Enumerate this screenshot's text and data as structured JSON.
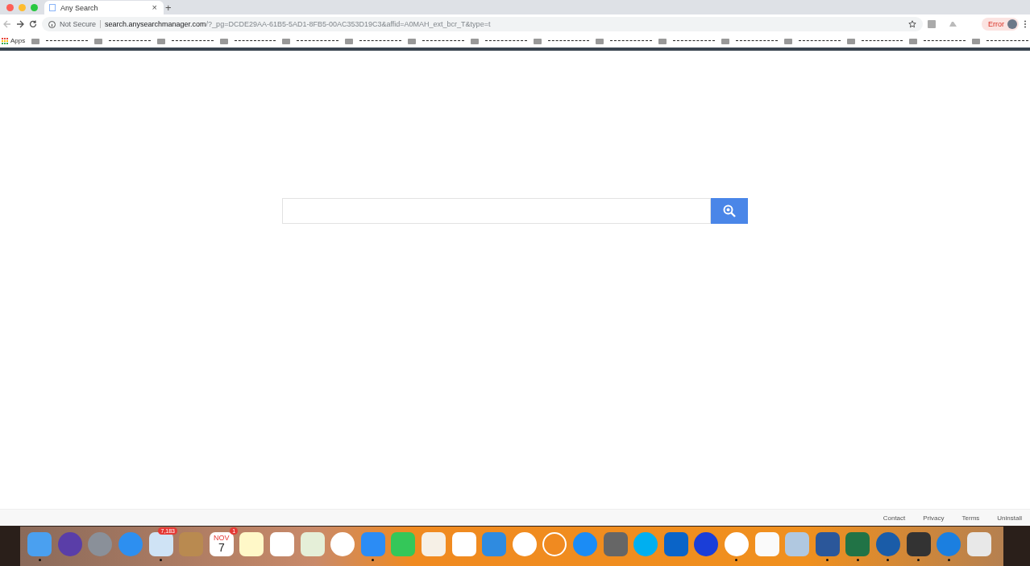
{
  "tab": {
    "title": "Any Search",
    "close": "×",
    "new_tab": "+"
  },
  "address_bar": {
    "security": "Not Secure",
    "host": "search.anysearchmanager.com",
    "path": "/?_pg=DCDE29AA-61B5-5AD1-8FB5-00AC353D19C3&affid=A0MAH_ext_bcr_T&type=t"
  },
  "profile": {
    "status": "Error"
  },
  "bookmarks": {
    "apps": "Apps"
  },
  "footer": {
    "links": [
      "Contact",
      "Privacy",
      "Terms",
      "Uninstall"
    ]
  },
  "dock": {
    "items": [
      {
        "running": true
      },
      {
        "running": false
      },
      {
        "running": false
      },
      {
        "running": false
      },
      {
        "running": true,
        "badge": "7,183"
      },
      {
        "running": false
      },
      {
        "running": false,
        "month": "NOV",
        "day": "7",
        "badge": "1"
      },
      {
        "running": false
      },
      {
        "running": false
      },
      {
        "running": false
      },
      {
        "running": false
      },
      {
        "running": true
      },
      {
        "running": false
      },
      {
        "running": false
      },
      {
        "running": false
      },
      {
        "running": false
      },
      {
        "running": false
      },
      {
        "running": false
      },
      {
        "running": false
      },
      {
        "running": false
      },
      {
        "running": false
      },
      {
        "running": false
      },
      {
        "running": false
      },
      {
        "running": true
      },
      {
        "running": false
      },
      {
        "running": false
      },
      {
        "running": true
      },
      {
        "running": true
      },
      {
        "running": true
      },
      {
        "running": true
      },
      {
        "running": true
      },
      {
        "running": false
      }
    ]
  }
}
